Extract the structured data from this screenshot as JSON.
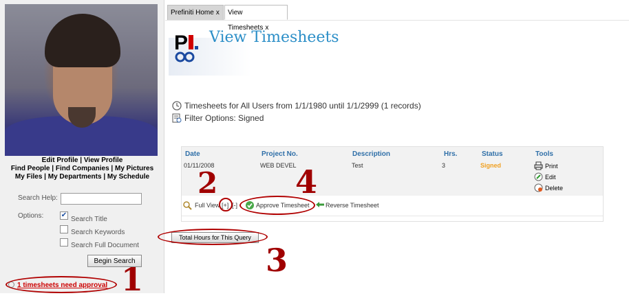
{
  "profile": {
    "links_row1": [
      "Edit Profile",
      "View Profile"
    ],
    "links_row2": [
      "Find People",
      "Find Companies",
      "My Pictures"
    ],
    "links_row3": [
      "My Files",
      "My Departments",
      "My Schedule"
    ]
  },
  "search": {
    "help_label": "Search Help:",
    "input_value": "",
    "options_label": "Options:",
    "options": [
      {
        "label": "Search Title",
        "checked": true
      },
      {
        "label": "Search Keywords",
        "checked": false
      },
      {
        "label": "Search Full Document",
        "checked": false
      }
    ],
    "button_label": "Begin Search"
  },
  "approval_link": "1 timesheets need approval",
  "tabs": [
    {
      "label": "Prefiniti Home",
      "active": false
    },
    {
      "label": "View Timesheets",
      "active": true
    }
  ],
  "tab_close_glyph": "x",
  "header": {
    "title": "View Timesheets",
    "logo_text": "PI"
  },
  "info": {
    "range_text": "Timesheets for All Users from 1/1/1980 until 1/1/2999 (1 records)",
    "filter_text": "Filter Options: Signed"
  },
  "table": {
    "columns": [
      "Date",
      "Project No.",
      "Description",
      "Hrs.",
      "Status",
      "Tools"
    ],
    "rows": [
      {
        "date": "01/11/2008",
        "project": "WEB DEVEL",
        "description": "Test",
        "hrs": "3",
        "status": "Signed"
      }
    ],
    "tools": [
      "Print",
      "Edit",
      "Delete"
    ]
  },
  "actions": {
    "full_view": "Full View",
    "expand": "[+]",
    "collapse": "[-]",
    "approve": "Approve Timesheet",
    "reverse": "Reverse Timesheet"
  },
  "total_button": "Total Hours for This Query",
  "annotations": [
    "1",
    "2",
    "3",
    "4"
  ],
  "colors": {
    "title_blue": "#2b8ec7",
    "header_blue": "#2f6fa8",
    "status_orange": "#f0a020",
    "annotation_red": "#a00000"
  }
}
